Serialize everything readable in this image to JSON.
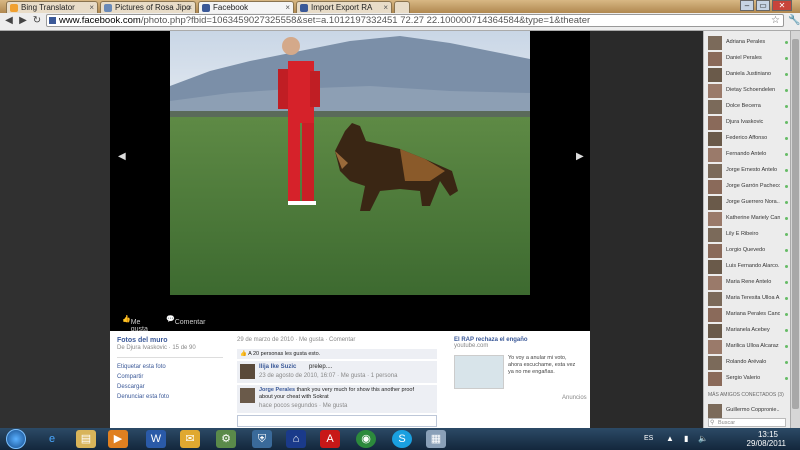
{
  "tabs": [
    {
      "label": "Bing Translator",
      "color": "#f0a030"
    },
    {
      "label": "Pictures of Rosa Jipo",
      "color": "#6a8ab8"
    },
    {
      "label": "Facebook",
      "color": "#3b5998"
    },
    {
      "label": "Import Export RA",
      "color": "#3b5998"
    }
  ],
  "address": {
    "host": "www.facebook.com",
    "path": "/photo.php?fbid=1063459027325558&set=a.1012197332451 72.27 22.100000714364584&type=1&theater"
  },
  "photo_actions": {
    "like": "Me gusta",
    "comment": "Comentar"
  },
  "album": {
    "title": "Fotos del muro",
    "subtitle": "De Djura Ivaskovic · 15 de 90",
    "links": [
      "Etiquetar esta foto",
      "Compartir",
      "Descargar",
      "Denunciar esta foto"
    ]
  },
  "post": {
    "meta": "29 de marzo de 2010 · Me gusta · Comentar",
    "likes": "A 20 personas les gusta esto.",
    "comments": [
      {
        "name": "Ilija Ike Suzic",
        "text": "prelep....",
        "meta": "23 de agosto de 2010, 16:07 · Me gusta · 1 persona"
      },
      {
        "name": "Jorge Perales",
        "text": "thank you very much for show this another proof about your cheat with Sokrat",
        "meta": "hace pocos segundos · Me gusta"
      }
    ]
  },
  "ad": {
    "title": "El RAP rechaza el engaño",
    "source": "youtube.com",
    "body": "Yo voy a anular mi voto, ahora escuchame, esta vez ya no me engañas.",
    "footer": "Anuncios"
  },
  "sidebar": {
    "friends": [
      "Adriana Perales",
      "Daniel Perales",
      "Daniela Justiniano",
      "Dietay Schoendelen",
      "Dolce Becerra",
      "Djura Ivaskovic",
      "Federico Affonso",
      "Fernando Antelo",
      "Jorge Ernesto Antelo",
      "Jorge Garrón Pacheco",
      "Jorge Guerrero Nora...",
      "Katherine Mariely Can...",
      "Lily E Ribeiro",
      "Lorgio Quevedo",
      "Luis Fernando Alarco...",
      "Maria Rene Antelo",
      "Maria Teresita Ulloa A",
      "Mariana Perales Cano",
      "Marianela Acebey",
      "Marilica Ulloa Alcaraz",
      "Rolando Arévalo",
      "Sergio Valerio"
    ],
    "section_label": "MÁS AMIGOS CONECTADOS (3)",
    "extra_friend": "Guillermo Coppronie...",
    "search_label": "Buscar"
  },
  "taskbar": {
    "lang": "ES",
    "time": "13:15",
    "date": "29/08/2011"
  }
}
